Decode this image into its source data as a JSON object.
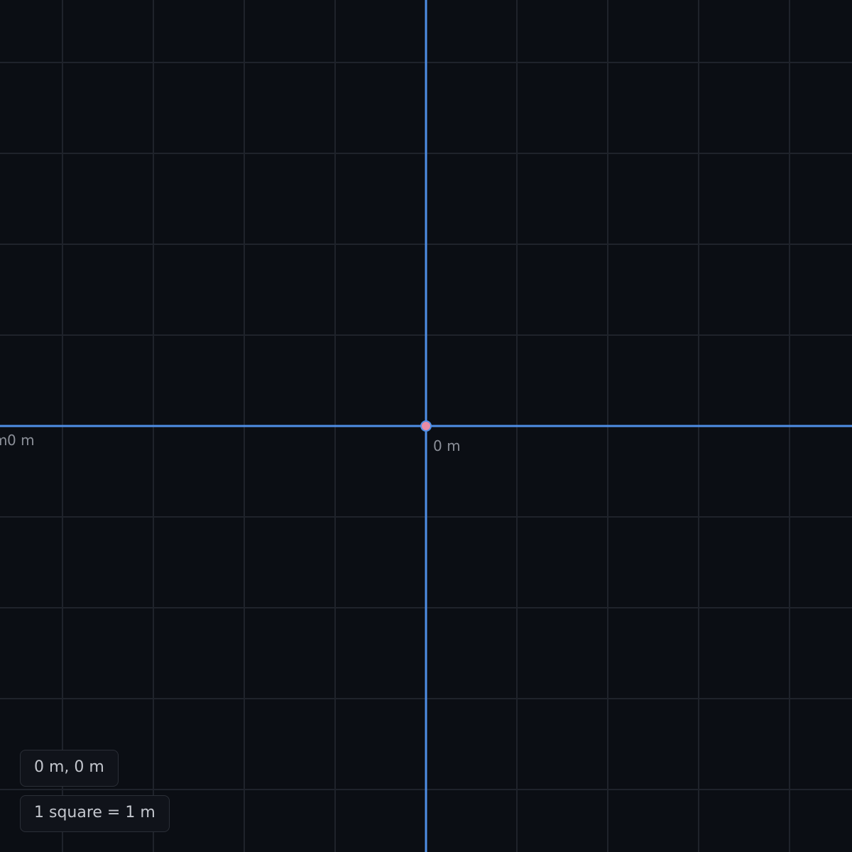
{
  "viewport": {
    "origin_label_x": "0 m",
    "origin_label_y": "0 m",
    "left_label": "0 m",
    "edge_label": "m",
    "cursor_coords": "0 m, 0 m",
    "scale_label": "1 square = 1 m"
  },
  "colors": {
    "background": "#0b0e14",
    "grid": "#1f232b",
    "axis": "#4f8fe6",
    "origin_marker": "#e88ca6"
  }
}
